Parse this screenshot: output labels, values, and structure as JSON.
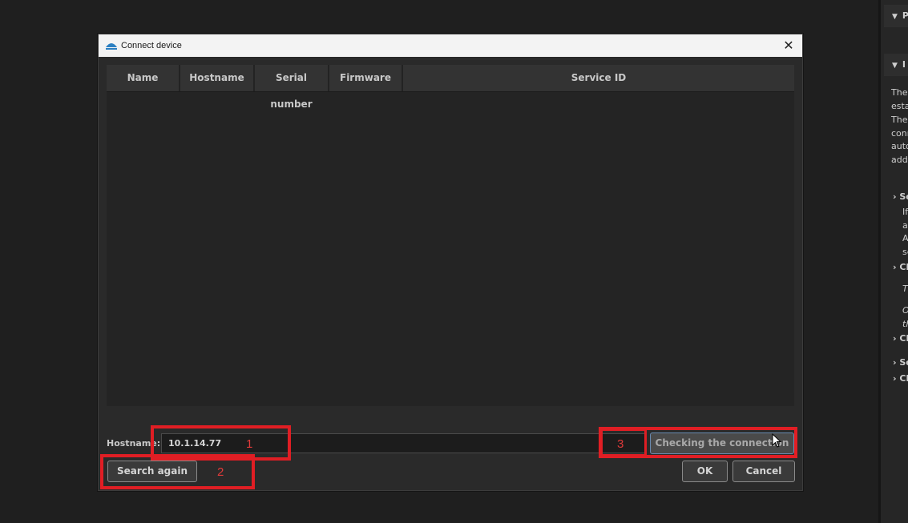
{
  "dialog": {
    "title": "Connect device",
    "columns": [
      "Name",
      "Hostname",
      "Serial number",
      "Firmware",
      "Service ID"
    ],
    "hostname_label": "Hostname:",
    "hostname_value": "10.1.14.77",
    "buttons": {
      "check": "Checking the connection",
      "search_again": "Search again",
      "ok": "OK",
      "cancel": "Cancel"
    }
  },
  "annotations": {
    "one": "1",
    "two": "2",
    "three": "3"
  },
  "side_panel": {
    "heading_1": "P",
    "heading_2": "I",
    "lines_a": [
      "The",
      "esta"
    ],
    "lines_b": [
      "The",
      "conn",
      "auto",
      "addr"
    ],
    "items": [
      "Se",
      "Cl",
      "Cl",
      "Se",
      "Cl"
    ],
    "sub_a": [
      "If",
      "ac",
      "A",
      "se"
    ],
    "sub_b": [
      "Th"
    ],
    "sub_c": [
      "Or",
      "th"
    ]
  },
  "colors": {
    "annotation": "#e01e24",
    "dialog_bg": "#2a2a2a",
    "titlebar_bg": "#f3f3f3"
  }
}
